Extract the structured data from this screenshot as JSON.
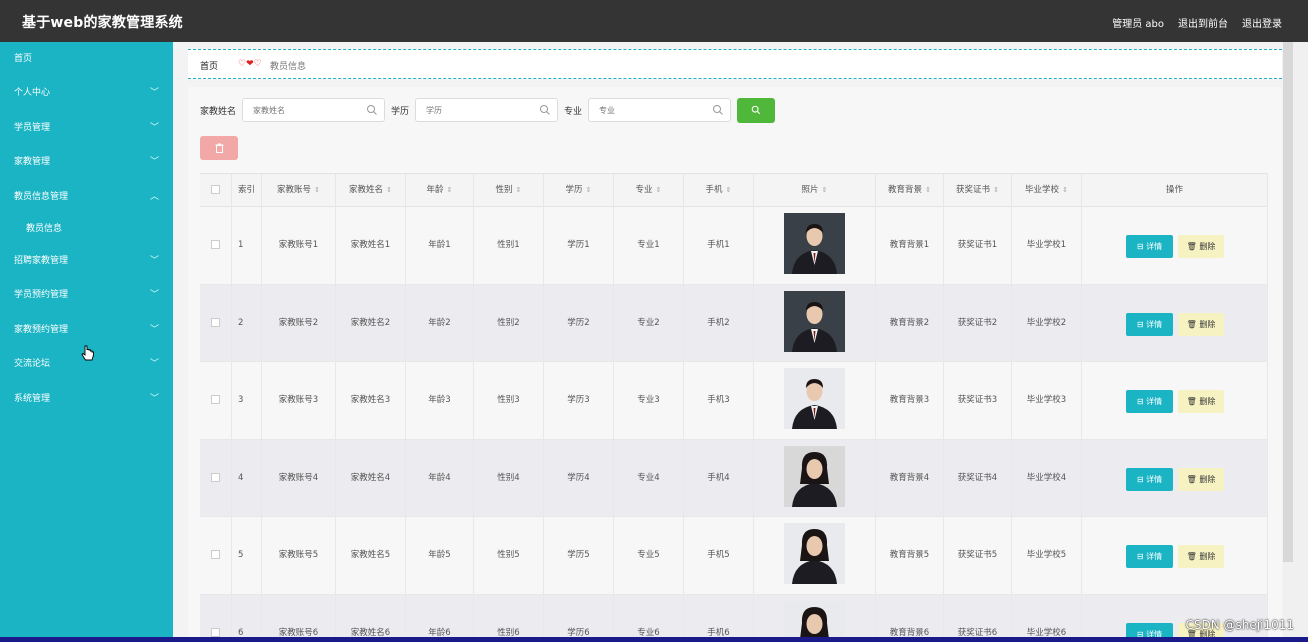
{
  "app": {
    "title": "基于web的家教管理系统",
    "top_links": [
      "管理员 abo",
      "退出到前台",
      "退出登录"
    ]
  },
  "sidebar": {
    "items": [
      {
        "label": "首页",
        "expand": false
      },
      {
        "label": "个人中心",
        "expand": true
      },
      {
        "label": "学员管理",
        "expand": true
      },
      {
        "label": "家教管理",
        "expand": true
      },
      {
        "label": "教员信息管理",
        "expand": true,
        "open": true
      },
      {
        "label": "招聘家教管理",
        "expand": true
      },
      {
        "label": "学员预约管理",
        "expand": true
      },
      {
        "label": "家教预约管理",
        "expand": true
      },
      {
        "label": "交流论坛",
        "expand": true
      },
      {
        "label": "系统管理",
        "expand": true
      }
    ],
    "sub_item": "教员信息"
  },
  "breadcrumb": {
    "home": "首页",
    "separator": "♡❤♡",
    "current": "教员信息"
  },
  "search": {
    "fields": [
      {
        "label": "家教姓名",
        "placeholder": "家教姓名"
      },
      {
        "label": "学历",
        "placeholder": "学历"
      },
      {
        "label": "专业",
        "placeholder": "专业"
      }
    ]
  },
  "table": {
    "columns": [
      "",
      "索引",
      "家教账号",
      "家教姓名",
      "年龄",
      "性别",
      "学历",
      "专业",
      "手机",
      "照片",
      "教育背景",
      "获奖证书",
      "毕业学校",
      "操作"
    ],
    "sortable": [
      false,
      false,
      true,
      true,
      true,
      true,
      true,
      true,
      true,
      true,
      true,
      true,
      true,
      false
    ],
    "actions": {
      "detail": "详情",
      "delete": "删除"
    },
    "rows": [
      [
        "1",
        "家教账号1",
        "家教姓名1",
        "年龄1",
        "性别1",
        "学历1",
        "专业1",
        "手机1",
        "教育背景1",
        "获奖证书1",
        "毕业学校1"
      ],
      [
        "2",
        "家教账号2",
        "家教姓名2",
        "年龄2",
        "性别2",
        "学历2",
        "专业2",
        "手机2",
        "教育背景2",
        "获奖证书2",
        "毕业学校2"
      ],
      [
        "3",
        "家教账号3",
        "家教姓名3",
        "年龄3",
        "性别3",
        "学历3",
        "专业3",
        "手机3",
        "教育背景3",
        "获奖证书3",
        "毕业学校3"
      ],
      [
        "4",
        "家教账号4",
        "家教姓名4",
        "年龄4",
        "性别4",
        "学历4",
        "专业4",
        "手机4",
        "教育背景4",
        "获奖证书4",
        "毕业学校4"
      ],
      [
        "5",
        "家教账号5",
        "家教姓名5",
        "年龄5",
        "性别5",
        "学历5",
        "专业5",
        "手机5",
        "教育背景5",
        "获奖证书5",
        "毕业学校5"
      ],
      [
        "6",
        "家教账号6",
        "家教姓名6",
        "年龄6",
        "性别6",
        "学历6",
        "专业6",
        "手机6",
        "教育背景6",
        "获奖证书6",
        "毕业学校6"
      ]
    ],
    "photos": [
      "suit-man-dark",
      "suit-man-dark",
      "suit-man-light",
      "suit-woman-seated",
      "woman-portrait",
      "woman-portrait-light"
    ]
  },
  "watermark": "CSDN @sheji1011",
  "colors": {
    "sidebar": "#1bb4c4",
    "topbar": "#343434",
    "search_button": "#4fb73a",
    "delete_batch": "#f3a8a8",
    "detail_button": "#1bb4c4",
    "delete_button": "#f6f2c2"
  }
}
